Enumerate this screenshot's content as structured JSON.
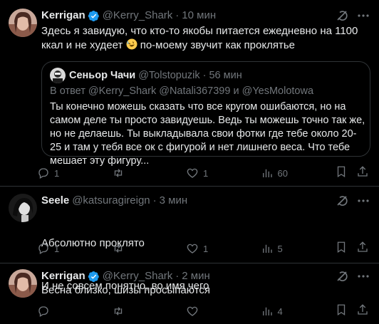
{
  "colors": {
    "background": "#000000",
    "text": "#e7e9ea",
    "muted": "#71767b",
    "border": "#2f3336",
    "verified": "#1d9bf0"
  },
  "post1": {
    "name": "Kerrigan",
    "handle": "@Kerry_Shark",
    "dot": "·",
    "time": "10 мин",
    "text_part1": "Здесь я завидую, что кто-то якобы питается ежедневно на 1100 ккал и не худеет ",
    "emoji": "rolling-on-floor-laughing-emoji",
    "text_part2": " по-моему звучит как проклятье",
    "quote": {
      "name": "Сеньор Чачи",
      "handle": "@Tolstopuzik",
      "dot": "·",
      "time": "56 мин",
      "reply_prefix": "В ответ",
      "reply_user1": "@Kerry_Shark",
      "reply_user2": "@Natali367399",
      "reply_and": "и",
      "reply_user3": "@YesMolotowa",
      "text": "Ты конечно можешь сказать что все кругом ошибаются, но на самом деле ты просто завидуешь. Ведь ты можешь точно так же, но не делаешь. Ты выкладывала свои фотки где тебе около 20-25 и там у тебя все ок с фигурой и нет лишнего веса. Что тебе мешает эту фигуру..."
    },
    "replies": "1",
    "reposts": "",
    "likes": "1",
    "views": "60"
  },
  "post2": {
    "name": "Seele",
    "handle": "@katsuragireign",
    "dot": "·",
    "time": "3 мин",
    "line1": "Абсолютно проклято",
    "line2": "И не совсем понятно, во имя чего",
    "replies": "1",
    "reposts": "",
    "likes": "1",
    "views": "5"
  },
  "post3": {
    "name": "Kerrigan",
    "handle": "@Kerry_Shark",
    "dot": "·",
    "time": "2 мин",
    "text": "Весна близко, шизы просыпаются",
    "replies": "",
    "reposts": "",
    "likes": "",
    "views": "4"
  }
}
